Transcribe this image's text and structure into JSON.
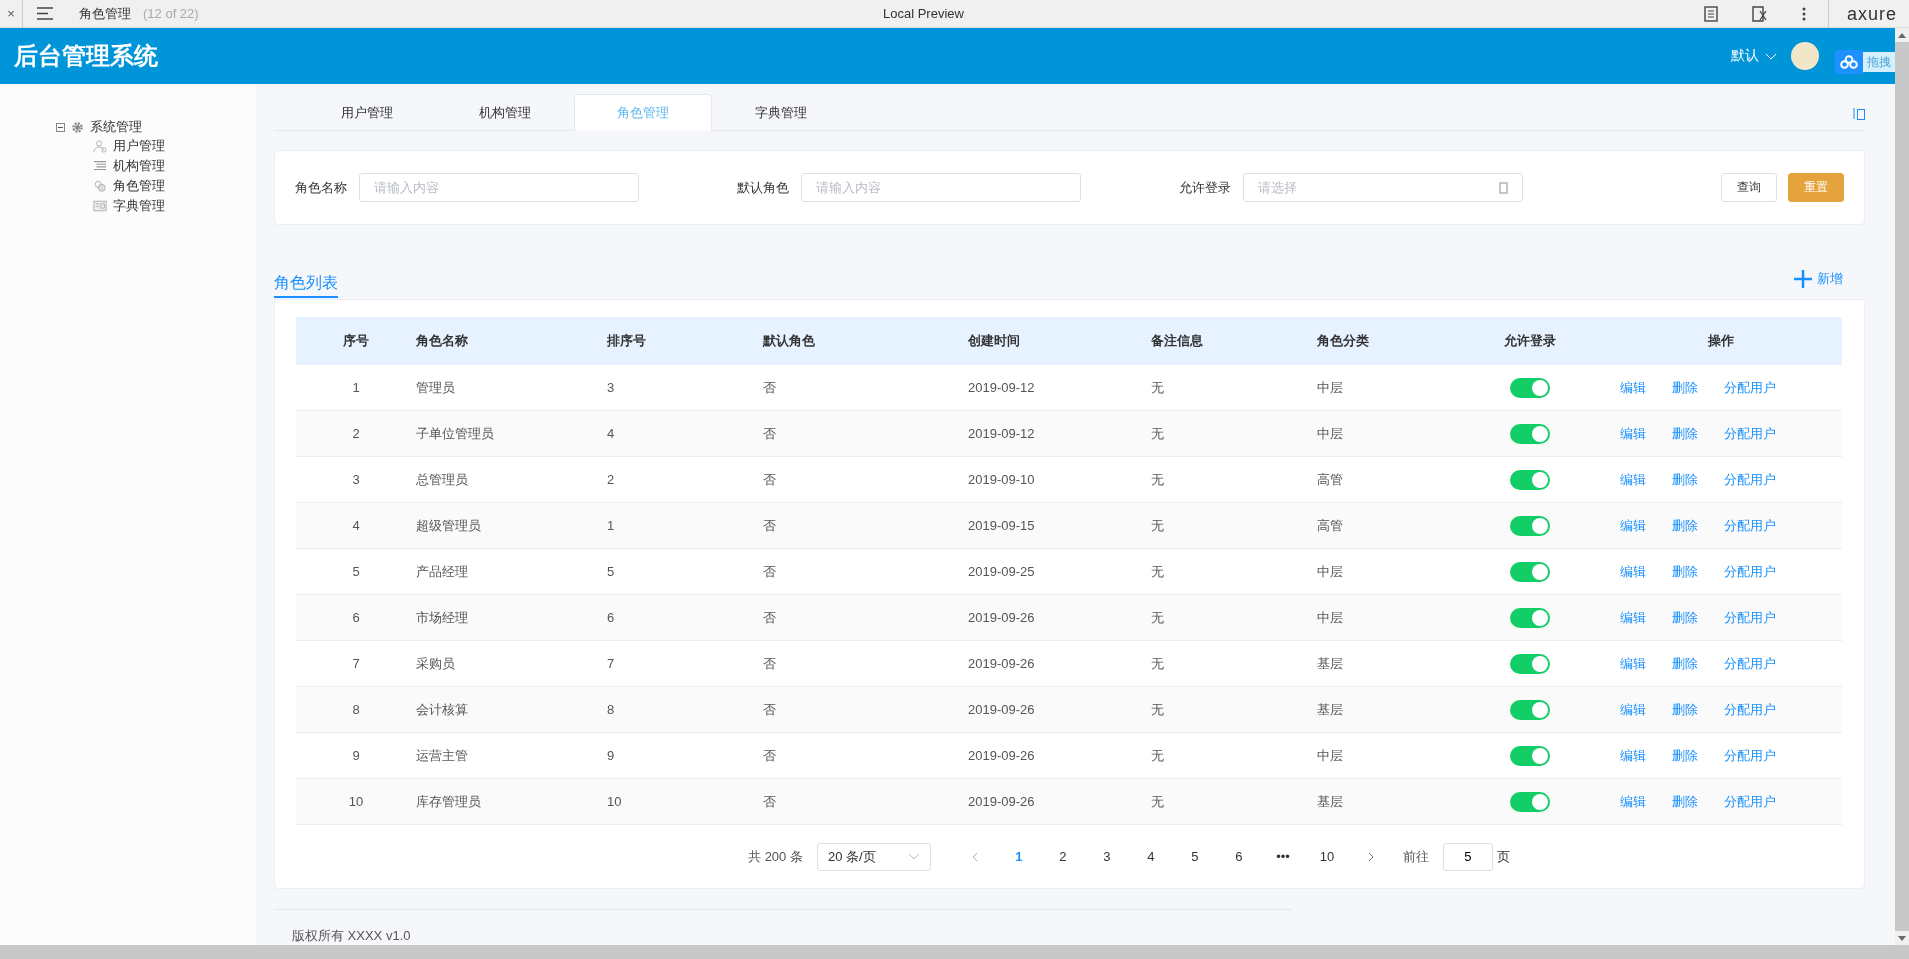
{
  "browser_bar": {
    "close": "×",
    "page_title": "角色管理",
    "page_count": "(12 of 22)",
    "center_title": "Local Preview",
    "logo": "axure"
  },
  "header": {
    "title": "后台管理系统",
    "role_select": "默认",
    "drag_widget": "拖拽"
  },
  "sidebar": {
    "items": [
      {
        "label": "系统管理",
        "expanded": true,
        "children": [
          {
            "label": "用户管理"
          },
          {
            "label": "机构管理"
          },
          {
            "label": "角色管理"
          },
          {
            "label": "字典管理"
          }
        ]
      }
    ]
  },
  "tabs": [
    {
      "label": "用户管理",
      "selected": false
    },
    {
      "label": "机构管理",
      "selected": false
    },
    {
      "label": "角色管理",
      "selected": true
    },
    {
      "label": "字典管理",
      "selected": false
    }
  ],
  "filters": [
    {
      "kind": "input",
      "label": "角色名称",
      "placeholder": "请输入内容"
    },
    {
      "kind": "input",
      "label": "默认角色",
      "placeholder": "请输入内容"
    },
    {
      "kind": "select",
      "label": "允许登录",
      "placeholder": "请选择"
    }
  ],
  "filter_buttons": {
    "search": "查询",
    "reset": "重置"
  },
  "list": {
    "title": "角色列表",
    "add": "新增"
  },
  "table": {
    "columns": [
      "序号",
      "角色名称",
      "排序号",
      "默认角色",
      "创建时间",
      "备注信息",
      "角色分类",
      "允许登录",
      "操作"
    ],
    "rows": [
      {
        "no": "1",
        "name": "管理员",
        "order": "3",
        "default": "否",
        "created": "2019-09-12",
        "note": "无",
        "category": "中层",
        "on": true,
        "actions": [
          "编辑",
          "删除",
          "分配用户"
        ]
      },
      {
        "no": "2",
        "name": "子单位管理员",
        "order": "4",
        "default": "否",
        "created": "2019-09-12",
        "note": "无",
        "category": "中层",
        "on": true,
        "actions": [
          "编辑",
          "删除",
          "分配用户"
        ]
      },
      {
        "no": "3",
        "name": "总管理员",
        "order": "2",
        "default": "否",
        "created": "2019-09-10",
        "note": "无",
        "category": "高管",
        "on": true,
        "actions": [
          "编辑",
          "删除",
          "分配用户"
        ]
      },
      {
        "no": "4",
        "name": "超级管理员",
        "order": "1",
        "default": "否",
        "created": "2019-09-15",
        "note": "无",
        "category": "高管",
        "on": true,
        "actions": [
          "编辑",
          "删除",
          "分配用户"
        ]
      },
      {
        "no": "5",
        "name": "产品经理",
        "order": "5",
        "default": "否",
        "created": "2019-09-25",
        "note": "无",
        "category": "中层",
        "on": true,
        "actions": [
          "编辑",
          "删除",
          "分配用户"
        ]
      },
      {
        "no": "6",
        "name": "市场经理",
        "order": "6",
        "default": "否",
        "created": "2019-09-26",
        "note": "无",
        "category": "中层",
        "on": true,
        "actions": [
          "编辑",
          "删除",
          "分配用户"
        ]
      },
      {
        "no": "7",
        "name": "采购员",
        "order": "7",
        "default": "否",
        "created": "2019-09-26",
        "note": "无",
        "category": "基层",
        "on": true,
        "actions": [
          "编辑",
          "删除",
          "分配用户"
        ]
      },
      {
        "no": "8",
        "name": "会计核算",
        "order": "8",
        "default": "否",
        "created": "2019-09-26",
        "note": "无",
        "category": "基层",
        "on": true,
        "actions": [
          "编辑",
          "删除",
          "分配用户"
        ]
      },
      {
        "no": "9",
        "name": "运营主管",
        "order": "9",
        "default": "否",
        "created": "2019-09-26",
        "note": "无",
        "category": "中层",
        "on": true,
        "actions": [
          "编辑",
          "删除",
          "分配用户"
        ]
      },
      {
        "no": "10",
        "name": "库存管理员",
        "order": "10",
        "default": "否",
        "created": "2019-09-26",
        "note": "无",
        "category": "基层",
        "on": true,
        "actions": [
          "编辑",
          "删除",
          "分配用户"
        ]
      }
    ]
  },
  "pagination": {
    "total": "共 200 条",
    "page_size": "20 条/页",
    "pages": [
      {
        "label": "1",
        "selected": true
      },
      {
        "label": "2",
        "selected": false
      },
      {
        "label": "3",
        "selected": false
      },
      {
        "label": "4",
        "selected": false
      },
      {
        "label": "5",
        "selected": false
      },
      {
        "label": "6",
        "selected": false
      },
      {
        "label": "•••",
        "selected": false
      },
      {
        "label": "10",
        "selected": false
      }
    ],
    "goto_label": "前往",
    "goto_value": "5",
    "goto_unit": "页"
  },
  "footer": "版权所有 XXXX v1.0"
}
